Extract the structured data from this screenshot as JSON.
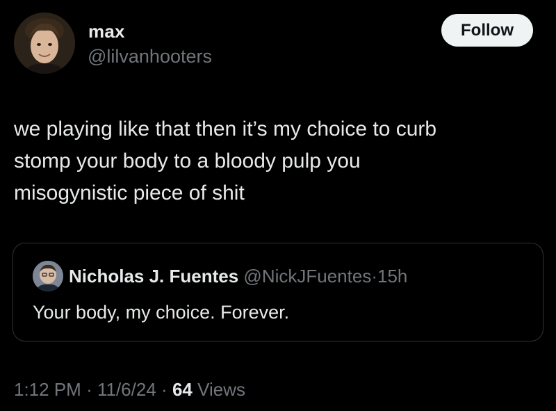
{
  "author": {
    "display_name": "max",
    "handle": "@lilvanhooters",
    "avatar_icon": "user-avatar"
  },
  "follow_button": {
    "label": "Follow"
  },
  "tweet": {
    "text_lines": [
      "we playing like that then it’s my choice to curb",
      "stomp your body to a bloody pulp you",
      "misogynistic piece of shit"
    ]
  },
  "quoted_tweet": {
    "display_name": "Nicholas J. Fuentes",
    "handle": "@NickJFuentes",
    "separator": "·",
    "time_ago": "15h",
    "text": "Your body, my choice. Forever.",
    "avatar_icon": "user-avatar"
  },
  "meta": {
    "time": "1:12 PM",
    "separator": "·",
    "date": "11/6/24",
    "views_count": "64",
    "views_label": "Views"
  },
  "colors": {
    "background": "#000000",
    "primary_text": "#e7e9ea",
    "secondary_text": "#71767b",
    "border": "#2f3336",
    "follow_button_bg": "#eff3f4"
  }
}
